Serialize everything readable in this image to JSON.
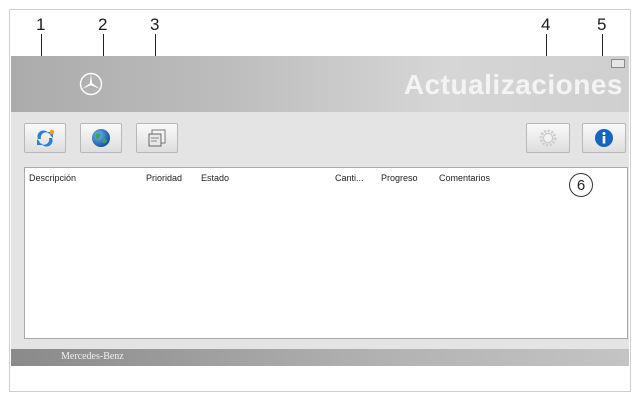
{
  "callouts": [
    "1",
    "2",
    "3",
    "4",
    "5",
    "6"
  ],
  "banner": {
    "title": "Actualizaciones"
  },
  "toolbar": {
    "buttons": [
      {
        "name": "refresh",
        "icon": "refresh-arrows-icon"
      },
      {
        "name": "internet",
        "icon": "globe-icon"
      },
      {
        "name": "installed",
        "icon": "document-window-icon"
      },
      {
        "name": "settings",
        "icon": "gear-icon"
      },
      {
        "name": "info",
        "icon": "info-icon"
      }
    ]
  },
  "table": {
    "columns": [
      "Descripción",
      "Prioridad",
      "Estado",
      "Canti...",
      "Progreso",
      "Comentarios"
    ],
    "rows": []
  },
  "footer": {
    "brand": "Mercedes-Benz"
  },
  "colors": {
    "info_blue": "#1565c0",
    "refresh_blue": "#2a7fd4",
    "refresh_orange": "#f0a020"
  }
}
